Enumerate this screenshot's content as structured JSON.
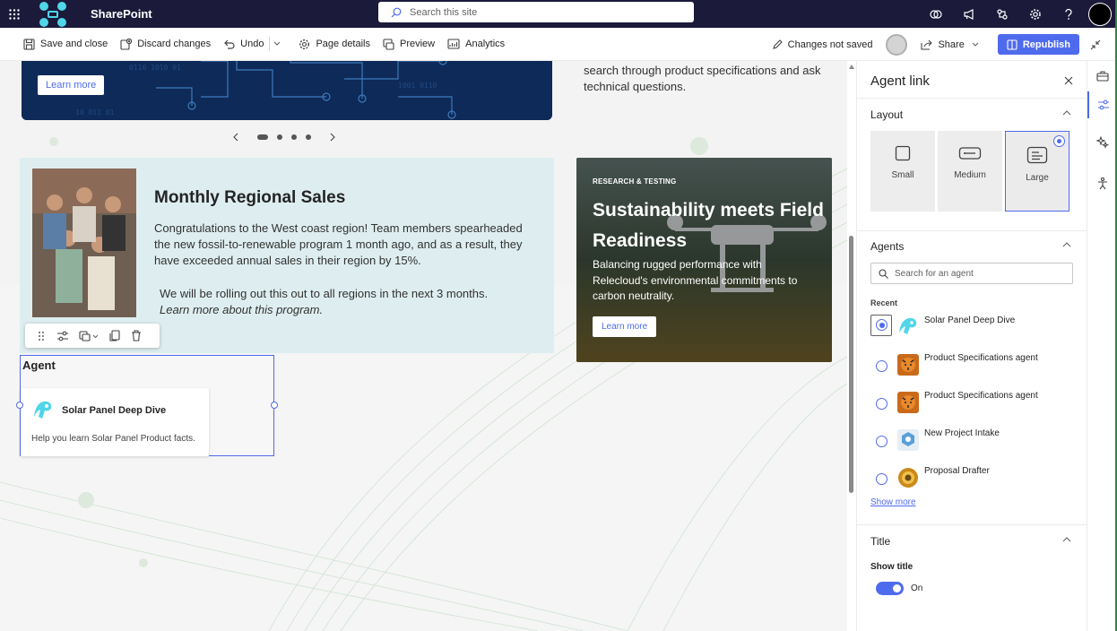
{
  "suite": {
    "app_name": "SharePoint",
    "search_placeholder": "Search this site",
    "icons": [
      "waffle-icon",
      "copilot-icon",
      "megaphone-icon",
      "share-network-icon",
      "gear-icon",
      "help-icon",
      "avatar"
    ]
  },
  "commandbar": {
    "save_close": "Save and close",
    "discard": "Discard changes",
    "undo": "Undo",
    "page_details": "Page details",
    "preview": "Preview",
    "analytics": "Analytics",
    "status": "Changes not saved",
    "share": "Share",
    "republish": "Republish"
  },
  "hero": {
    "learn_more": "Learn more",
    "side_text": "search through product specifications and ask technical questions."
  },
  "sales": {
    "title": "Monthly Regional Sales",
    "body": "Congratulations to the West coast region! Team members spearheaded the new fossil-to-renewable program 1 month ago, and as a result, they have exceeded annual sales in their region by 15%.",
    "body2": "We will be rolling out this out to all regions in the next 3 months.",
    "body2_italic": "Learn more about this program."
  },
  "agent_webpart": {
    "title": "Agent",
    "card_name": "Solar Panel Deep Dive",
    "card_desc": "Help you learn Solar Panel Product facts."
  },
  "promo": {
    "kicker": "RESEARCH & TESTING",
    "title": "Sustainability meets Field Readiness",
    "desc": "Balancing rugged performance with Relecloud's environmental commitments to carbon neutrality.",
    "button": "Learn more"
  },
  "pane": {
    "title": "Agent link",
    "layout_label": "Layout",
    "layout_options": [
      "Small",
      "Medium",
      "Large"
    ],
    "layout_selected": "Large",
    "agents_label": "Agents",
    "search_placeholder": "Search for an agent",
    "recent_label": "Recent",
    "agents": [
      {
        "name": "Solar Panel Deep Dive",
        "icon": "solar-agent-icon",
        "selected": true
      },
      {
        "name": "Product Specifications agent",
        "icon": "tiger-agent-icon",
        "selected": false
      },
      {
        "name": "Product Specifications agent",
        "icon": "tiger-agent-icon",
        "selected": false
      },
      {
        "name": "New Project Intake",
        "icon": "hex-agent-icon",
        "selected": false
      },
      {
        "name": "Proposal Drafter",
        "icon": "sun-agent-icon",
        "selected": false
      }
    ],
    "show_more": "Show more",
    "title_section": "Title",
    "show_title_label": "Show title",
    "toggle_state": "On"
  },
  "colors": {
    "suitebar": "#1b1a3a",
    "accent": "#4f6bed",
    "sales_card_bg": "#deeef0"
  }
}
